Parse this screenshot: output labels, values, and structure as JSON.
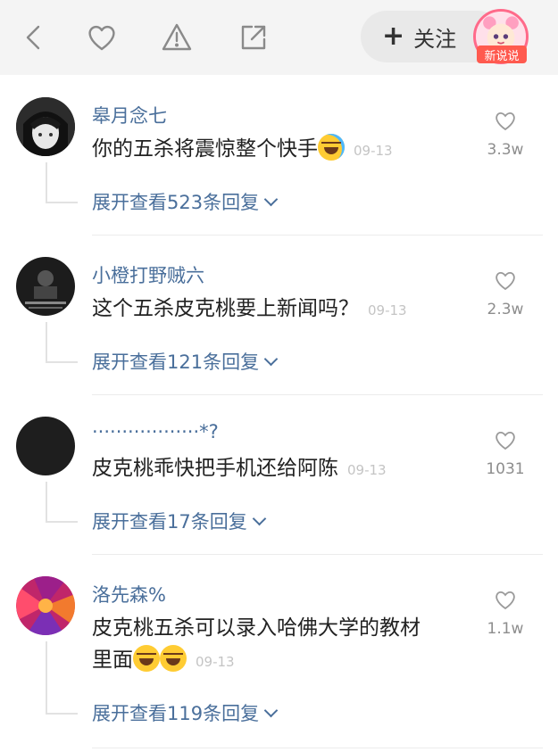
{
  "header": {
    "back_icon": "chevron-left-icon",
    "like_icon": "heart-icon",
    "report_icon": "warning-triangle-icon",
    "share_icon": "share-external-icon",
    "follow_plus": "+",
    "follow_label": "关注",
    "badge_label": "新说说"
  },
  "comments": [
    {
      "name": "皋月念七",
      "text": "你的五杀将震惊整个快手",
      "emoji": "laughing-crying-emoji",
      "date": "09-13",
      "likes": "3.3w",
      "expand": "展开查看523条回复"
    },
    {
      "name": "小橙打野贼六",
      "text": "这个五杀皮克桃要上新闻吗？",
      "date": "09-13",
      "likes": "2.3w",
      "expand": "展开查看121条回复"
    },
    {
      "name": "··················*?",
      "text": "皮克桃乖快把手机还给阿陈",
      "date": "09-13",
      "likes": "1031",
      "expand": "展开查看17条回复"
    },
    {
      "name": "洛先森%",
      "text_line1": "皮克桃五杀可以录入哈佛大学的教材",
      "text_line2": "里面",
      "emoji": "clapping-laughing-emoji",
      "date": "09-13",
      "likes": "1.1w",
      "expand": "展开查看119条回复"
    }
  ],
  "colors": {
    "header_bg": "#f4f4f4",
    "name_blue": "#4a6f9b",
    "badge_red": "#ff5a4f",
    "divider": "#ececec"
  }
}
